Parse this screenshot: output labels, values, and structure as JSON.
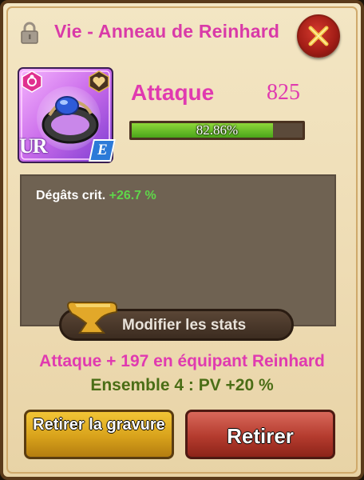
{
  "header": {
    "title": "Vie - Anneau de Reinhard"
  },
  "item": {
    "rarity": "UR",
    "grade": "E",
    "icon": "ring-icon",
    "attribute_icon": "heart-icon",
    "type_icon": "flower-icon"
  },
  "main_stat": {
    "name": "Attaque",
    "value": "825",
    "progress_label": "82.86%",
    "progress_fraction": 0.8286
  },
  "sub_stats": [
    {
      "name": "Dégâts crit.",
      "value": "+26.7 %"
    }
  ],
  "modify_button": {
    "label": "Modifier les stats"
  },
  "bonus_text": "Attaque + 197 en équipant Reinhard",
  "set_text": "Ensemble 4 : PV +20 %",
  "buttons": {
    "remove_engraving": "Retirer la gravure",
    "remove": "Retirer"
  },
  "colors": {
    "title": "#d93aa8",
    "bonus": "#e03ab0",
    "set": "#4b6e16",
    "positive": "#5fd64a",
    "bar_fill": "#6bc229"
  }
}
